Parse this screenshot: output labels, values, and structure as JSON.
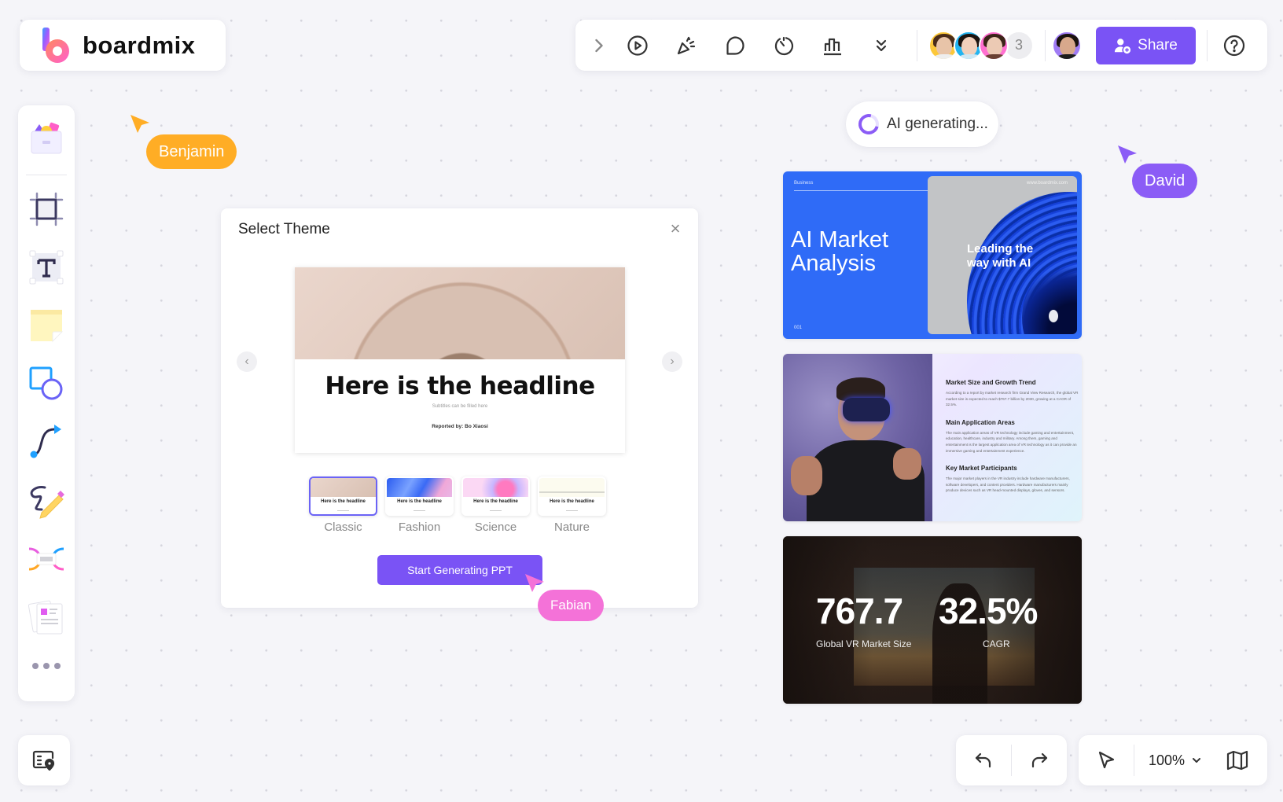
{
  "app": {
    "logo_text": "boardmix",
    "brand_color": "#7a53f5"
  },
  "topbar": {
    "icons": [
      "expand-chevron-icon",
      "play-icon",
      "celebrate-icon",
      "comment-icon",
      "timer-icon",
      "vote-chart-icon",
      "more-chevron-icon"
    ],
    "collaborator_extra_count": "3",
    "share_label": "Share",
    "help_icon": "help-icon"
  },
  "left_toolbar": {
    "tools": [
      "templates",
      "frame",
      "text",
      "sticky-note",
      "shapes",
      "connector",
      "pen",
      "mind-map",
      "document"
    ],
    "more_icon": "more-dots-icon"
  },
  "cursors": [
    {
      "name": "Benjamin",
      "color": "#ffad25"
    },
    {
      "name": "David",
      "color": "#8b5cf6"
    },
    {
      "name": "Fabian",
      "color": "#f472d8"
    }
  ],
  "dialog": {
    "title": "Select Theme",
    "preview": {
      "headline": "Here is the headline",
      "subtitle": "Subtitles can be filled here",
      "reported_by": "Reported by:   Bo Xiaosi"
    },
    "themes": [
      {
        "label": "Classic",
        "thumb_headline": "Here is the headline",
        "selected": true
      },
      {
        "label": "Fashion",
        "thumb_headline": "Here is the headline",
        "selected": false
      },
      {
        "label": "Science",
        "thumb_headline": "Here is the headline",
        "selected": false
      },
      {
        "label": "Nature",
        "thumb_headline": "Here is the headline",
        "selected": false
      }
    ],
    "generate_label": "Start Generating PPT"
  },
  "ai_status": "AI generating...",
  "slides": {
    "slide1": {
      "top_label": "Business",
      "url": "www.boardmix.com",
      "title_line1": "AI Market",
      "title_line2": "Analysis",
      "tagline_line1": "Leading the",
      "tagline_line2": "way with AI",
      "page_num": "001"
    },
    "slide2": {
      "sections": [
        {
          "heading": "Market Size and Growth Trend",
          "body": "According to a report by market research firm Grand View Research, the global VR market size is expected to reach $767.7 billion by 2030, growing at a CAGR of 32.5%."
        },
        {
          "heading": "Main Application Areas",
          "body": "The main application areas of VR technology include gaming and entertainment, education, healthcare, industry and military. Among them, gaming and entertainment is the largest application area of VR technology as it can provide an immersive gaming and entertainment experience."
        },
        {
          "heading": "Key Market Participants",
          "body": "The major market players in the VR industry include hardware manufacturers, software developers, and content providers. Hardware manufacturers mainly produce devices such as VR head-mounted displays, gloves, and sensors."
        }
      ]
    },
    "slide3": {
      "value1": "767.7",
      "label1": "Global VR Market Size",
      "value2": "32.5%",
      "label2": "CAGR"
    }
  },
  "bottom": {
    "zoom_level": "100%"
  }
}
